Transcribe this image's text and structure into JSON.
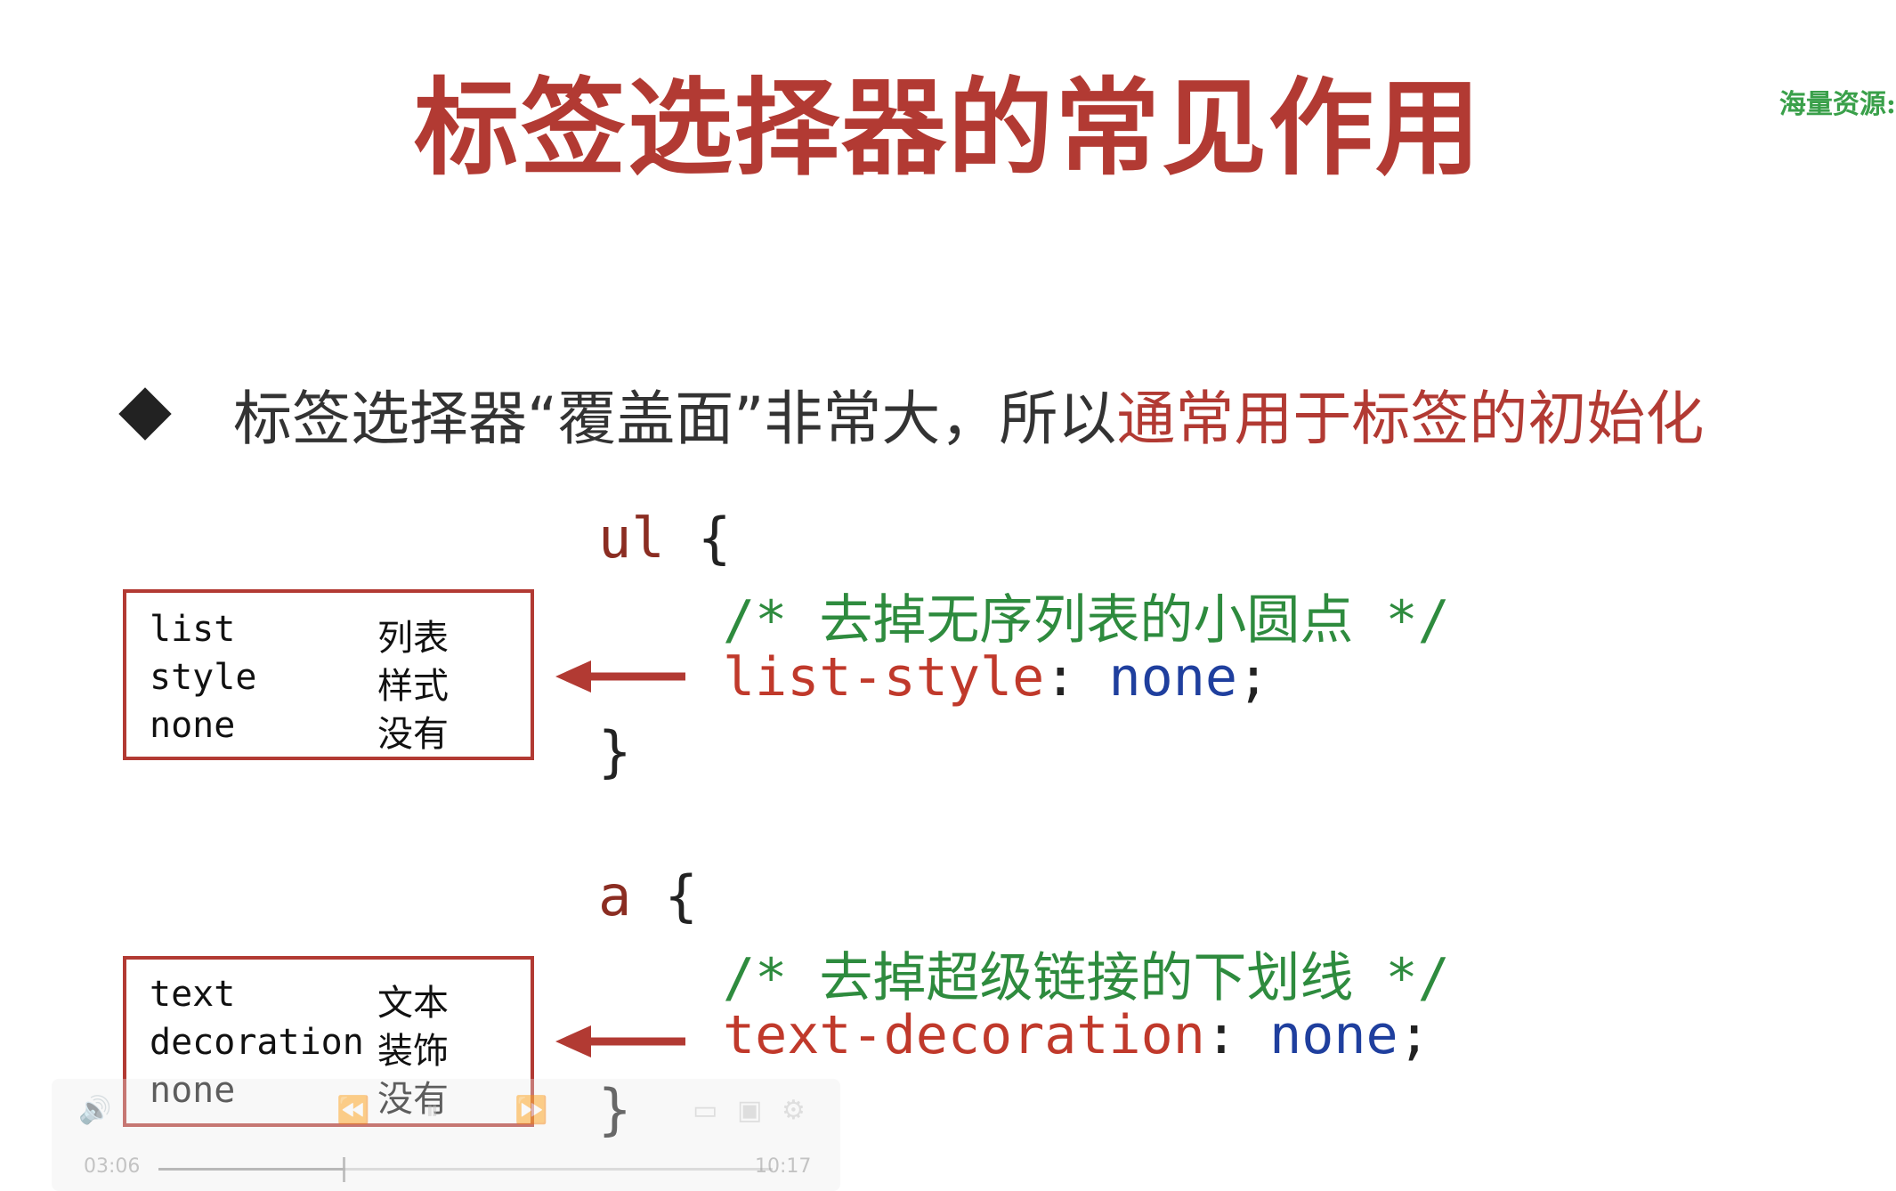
{
  "slide": {
    "title": "标签选择器的常见作用",
    "watermark": "海量资源:",
    "bullet_plain": "标签选择器“覆盖面”非常大，所以",
    "bullet_highlight": "通常用于标签的初始化"
  },
  "code_ul": {
    "selector": "ul",
    "open": "{",
    "comment": "/* 去掉无序列表的小圆点 */",
    "property": "list-style",
    "colon": ":",
    "value": "none",
    "semicolon": ";",
    "close": "}"
  },
  "code_a": {
    "selector": "a",
    "open": "{",
    "comment": "/* 去掉超级链接的下划线 */",
    "property": "text-decoration",
    "colon": ":",
    "value": "none",
    "semicolon": ";",
    "close": "}"
  },
  "box_list": {
    "rows": [
      {
        "en": "list",
        "zh": "列表"
      },
      {
        "en": "style",
        "zh": "样式"
      },
      {
        "en": "none",
        "zh": "没有"
      }
    ]
  },
  "box_text": {
    "rows": [
      {
        "en": "text",
        "zh": "文本"
      },
      {
        "en": "decoration",
        "zh": "装饰"
      },
      {
        "en": "none",
        "zh": "没有"
      }
    ]
  },
  "player": {
    "current_time": "03:06",
    "total_time": "10:17",
    "progress": 0.3,
    "icons": [
      "volume-icon",
      "rewind-icon",
      "pause-icon",
      "forward-icon",
      "subtitle-icon",
      "screen-icon",
      "settings-icon"
    ]
  },
  "colors": {
    "title": "#b23a33",
    "highlight": "#b23a33",
    "comment": "#2e8b3e",
    "value": "#1f3f9e",
    "border": "#b23a33",
    "watermark": "#3aa04a"
  }
}
